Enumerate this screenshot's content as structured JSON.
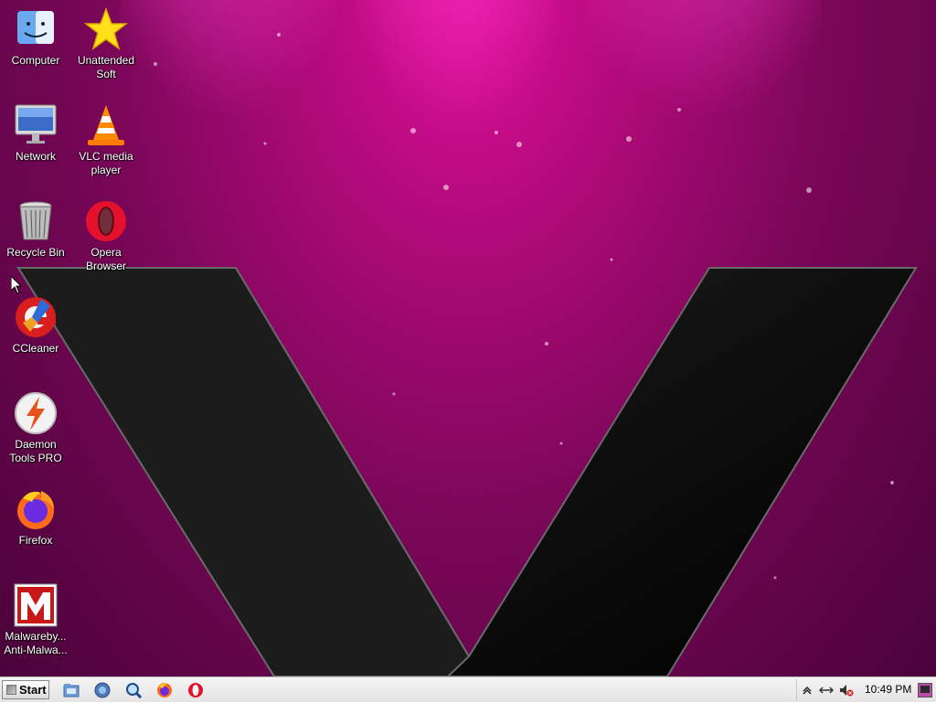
{
  "desktop": {
    "icons": [
      {
        "label": "Computer",
        "icon": "finder-computer-icon"
      },
      {
        "label": "Unattended Soft",
        "icon": "star-icon"
      },
      {
        "label": "Network",
        "icon": "monitor-network-icon"
      },
      {
        "label": "VLC media player",
        "icon": "vlc-cone-icon"
      },
      {
        "label": "Recycle Bin",
        "icon": "recycle-bin-icon"
      },
      {
        "label": "Opera Browser",
        "icon": "opera-icon"
      },
      {
        "label": "CCleaner",
        "icon": "ccleaner-icon"
      },
      {
        "label": "Daemon Tools PRO",
        "icon": "daemon-tools-icon"
      },
      {
        "label": "Firefox",
        "icon": "firefox-icon"
      },
      {
        "label": "Malwareby... Anti-Malwa...",
        "icon": "malwarebytes-icon"
      }
    ]
  },
  "taskbar": {
    "start_label": "Start",
    "quick_launch": [
      "explorer-folder-icon",
      "media-player-icon",
      "search-icon",
      "firefox-icon",
      "opera-icon"
    ],
    "tray": {
      "icons": [
        "chevron-up-icon",
        "network-icon",
        "volume-muted-icon",
        "desktop-icon"
      ],
      "clock": "10:49 PM"
    }
  },
  "colors": {
    "wallpaper_pink": "#e0109c",
    "wallpaper_dark": "#4a033a",
    "taskbar_bg": "#ececec"
  }
}
